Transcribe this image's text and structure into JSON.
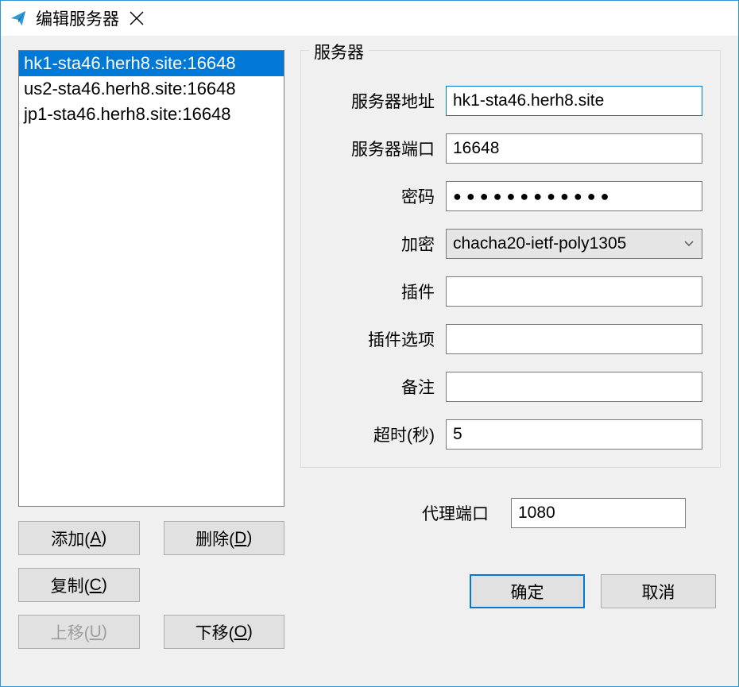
{
  "window": {
    "title": "编辑服务器",
    "icon_name": "paper-plane-icon"
  },
  "servers": {
    "items": [
      {
        "label": "hk1-sta46.herh8.site:16648",
        "selected": true
      },
      {
        "label": "us2-sta46.herh8.site:16648",
        "selected": false
      },
      {
        "label": "jp1-sta46.herh8.site:16648",
        "selected": false
      }
    ]
  },
  "list_buttons": {
    "add": {
      "prefix": "添加(",
      "key": "A",
      "suffix": ")"
    },
    "delete": {
      "prefix": "删除(",
      "key": "D",
      "suffix": ")"
    },
    "copy": {
      "prefix": "复制(",
      "key": "C",
      "suffix": ")"
    },
    "move_up": {
      "prefix": "上移(",
      "key": "U",
      "suffix": ")",
      "disabled": true
    },
    "move_down": {
      "prefix": "下移(",
      "key": "O",
      "suffix": ")"
    }
  },
  "group": {
    "title": "服务器",
    "fields": {
      "address": {
        "label": "服务器地址",
        "value": "hk1-sta46.herh8.site"
      },
      "port": {
        "label": "服务器端口",
        "value": "16648"
      },
      "password": {
        "label": "密码",
        "masked": "●●●●●●●●●●●●"
      },
      "encryption": {
        "label": "加密",
        "value": "chacha20-ietf-poly1305"
      },
      "plugin": {
        "label": "插件",
        "value": ""
      },
      "plugin_opts": {
        "label": "插件选项",
        "value": ""
      },
      "remark": {
        "label": "备注",
        "value": ""
      },
      "timeout": {
        "label": "超时(秒)",
        "value": "5"
      }
    }
  },
  "proxy": {
    "label": "代理端口",
    "value": "1080"
  },
  "dialog": {
    "ok": "确定",
    "cancel": "取消"
  }
}
